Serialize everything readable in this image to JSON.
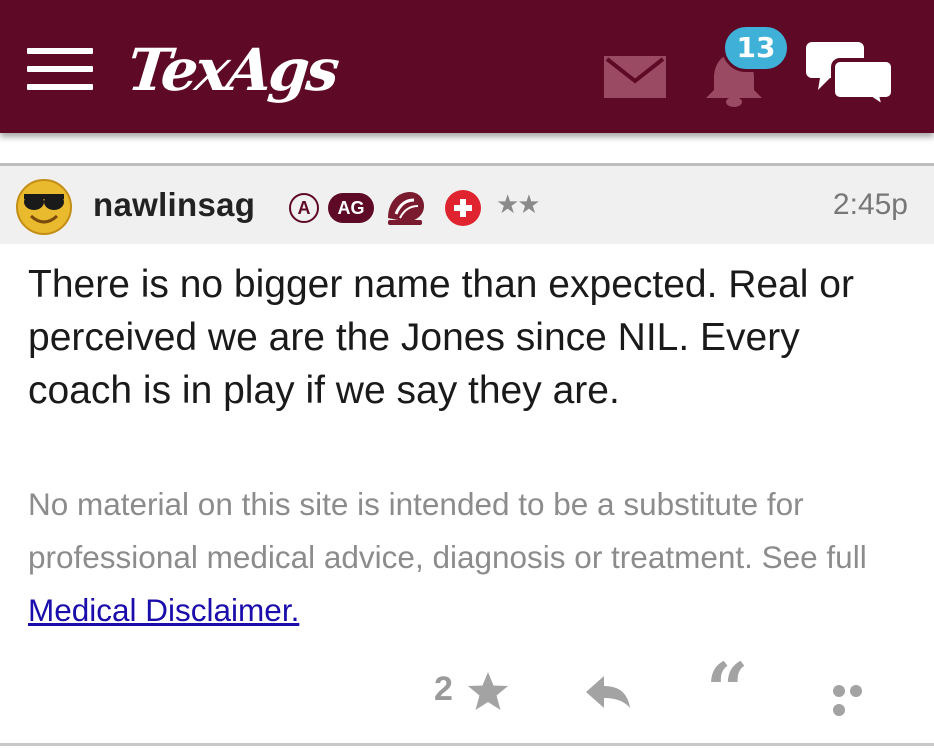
{
  "header": {
    "logo_text": "TexAgs",
    "notification_count": "13",
    "brand_color": "#5e0a27",
    "badge_color": "#3fb1d8",
    "icons": [
      "menu-icon",
      "mail-icon",
      "bell-icon",
      "chat-icon"
    ]
  },
  "post": {
    "username": "nawlinsag",
    "badges": {
      "a_label": "A",
      "ag_label": "AG",
      "rank_stars": "★★"
    },
    "timestamp": "2:45p",
    "body": "There is no bigger name than expected. Real or perceived we are the Jones since NIL. Every coach is in play if we say they are."
  },
  "disclaimer": {
    "text": "No material on this site is intended to be a substitute for professional medical advice, diagnosis or treatment. See full ",
    "link_text": "Medical Disclaimer."
  },
  "actions": {
    "star_count": "2",
    "quote_glyph": "“"
  }
}
